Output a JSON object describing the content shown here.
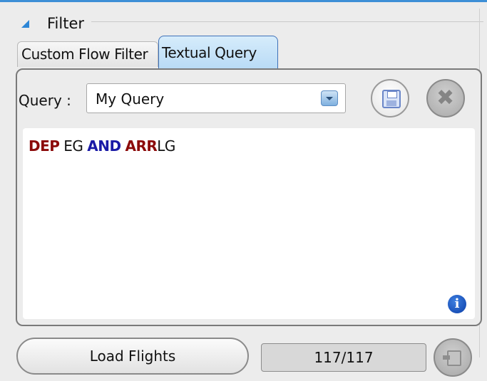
{
  "group": {
    "title": "Filter"
  },
  "tabs": [
    {
      "label": "Custom Flow Filter",
      "active": false
    },
    {
      "label": "Textual Query",
      "active": true
    }
  ],
  "query": {
    "label": "Query :",
    "selected": "My Query",
    "tokens": {
      "t1": "DEP",
      "t2": "EG",
      "t3": "AND",
      "t4": "ARR",
      "t5": "LG"
    }
  },
  "footer": {
    "load_label": "Load Flights",
    "count": "117/117"
  },
  "icons": {
    "collapse": "triangle-collapse-icon",
    "dropdown": "chevron-down-icon",
    "save": "floppy-disk-icon",
    "delete": "delete-icon",
    "info": "info-icon",
    "export": "export-icon"
  },
  "colors": {
    "keyword_dep_arr": "#8b0a0a",
    "keyword_and": "#1a1aa6",
    "accent": "#3d8fd6"
  }
}
